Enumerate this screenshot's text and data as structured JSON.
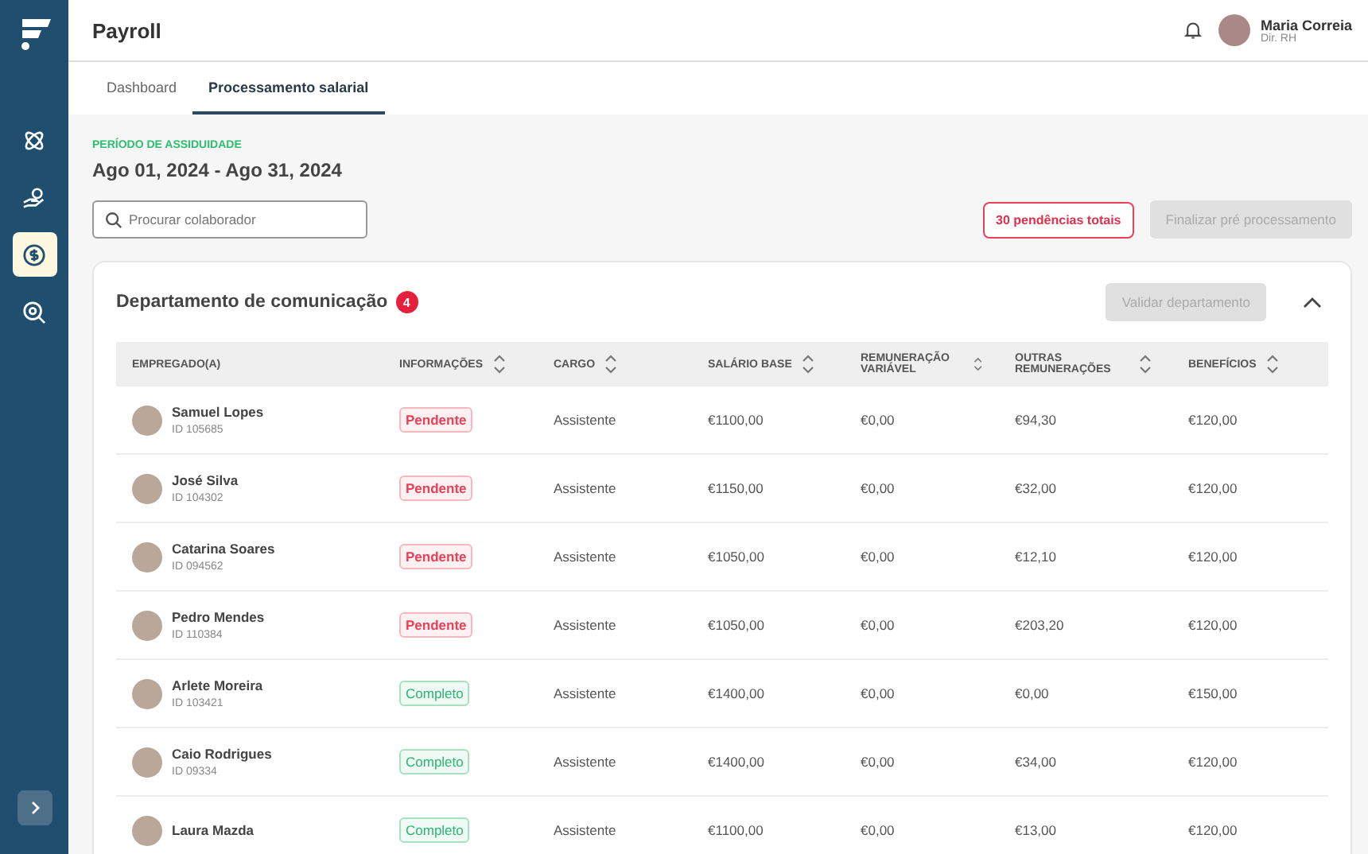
{
  "app": {
    "title": "Payroll"
  },
  "sidebar": {
    "items": [
      {
        "selected": false
      },
      {
        "selected": false
      },
      {
        "selected": true
      },
      {
        "selected": false
      }
    ]
  },
  "user": {
    "name": "Maria Correia",
    "role": "Dir. RH"
  },
  "tabs": [
    {
      "label": "Dashboard",
      "selected": false
    },
    {
      "label": "Processamento salarial",
      "selected": true
    }
  ],
  "period": {
    "label": "PERÍODO DE ASSIDUIDADE",
    "range": "Ago 01, 2024 - Ago 31, 2024"
  },
  "search": {
    "placeholder": "Procurar colaborador"
  },
  "pending_total": "30 pendências totais",
  "finalize_button": {
    "label": "Finalizar pré processamento",
    "disabled": true
  },
  "department": {
    "name": "Departamento de comunicação",
    "count": "4",
    "validate_button": {
      "label": "Validar departamento",
      "disabled": true
    },
    "expanded": true,
    "table": {
      "columns": [
        {
          "label": "EMPREGADO(A)",
          "sortable": false
        },
        {
          "label": "INFORMAÇÕES",
          "sortable": true
        },
        {
          "label": "CARGO",
          "sortable": true
        },
        {
          "label": "SALÁRIO BASE",
          "sortable": true
        },
        {
          "label": "REMUNERAÇÃO VARIÁVEL",
          "sortable": true
        },
        {
          "label": "OUTRAS REMUNERAÇÕES",
          "sortable": true
        },
        {
          "label": "BENEFÍCIOS",
          "sortable": true
        }
      ],
      "rows": [
        {
          "name": "Samuel Lopes",
          "id": "ID 105685",
          "status": {
            "label": "Pendente",
            "kind": "pending"
          },
          "role": "Assistente",
          "base": "€1100,00",
          "variable": "€0,00",
          "other": "€94,30",
          "benefits": "€120,00"
        },
        {
          "name": "José Silva",
          "id": "ID 104302",
          "status": {
            "label": "Pendente",
            "kind": "pending"
          },
          "role": "Assistente",
          "base": "€1150,00",
          "variable": "€0,00",
          "other": "€32,00",
          "benefits": "€120,00"
        },
        {
          "name": "Catarina Soares",
          "id": "ID 094562",
          "status": {
            "label": "Pendente",
            "kind": "pending"
          },
          "role": "Assistente",
          "base": "€1050,00",
          "variable": "€0,00",
          "other": "€12,10",
          "benefits": "€120,00"
        },
        {
          "name": "Pedro Mendes",
          "id": "ID 110384",
          "status": {
            "label": "Pendente",
            "kind": "pending"
          },
          "role": "Assistente",
          "base": "€1050,00",
          "variable": "€0,00",
          "other": "€203,20",
          "benefits": "€120,00"
        },
        {
          "name": "Arlete Moreira",
          "id": "ID 103421",
          "status": {
            "label": "Completo",
            "kind": "complete"
          },
          "role": "Assistente",
          "base": "€1400,00",
          "variable": "€0,00",
          "other": "€0,00",
          "benefits": "€150,00"
        },
        {
          "name": "Caio Rodrigues",
          "id": "ID 09334",
          "status": {
            "label": "Completo",
            "kind": "complete"
          },
          "role": "Assistente",
          "base": "€1400,00",
          "variable": "€0,00",
          "other": "€34,00",
          "benefits": "€120,00"
        },
        {
          "name": "Laura Mazda",
          "status": {
            "label": "Completo",
            "kind": "complete"
          },
          "role": "Assistente",
          "base": "€1100,00",
          "variable": "€0,00",
          "other": "€13,00",
          "benefits": "€120,00"
        }
      ]
    }
  }
}
